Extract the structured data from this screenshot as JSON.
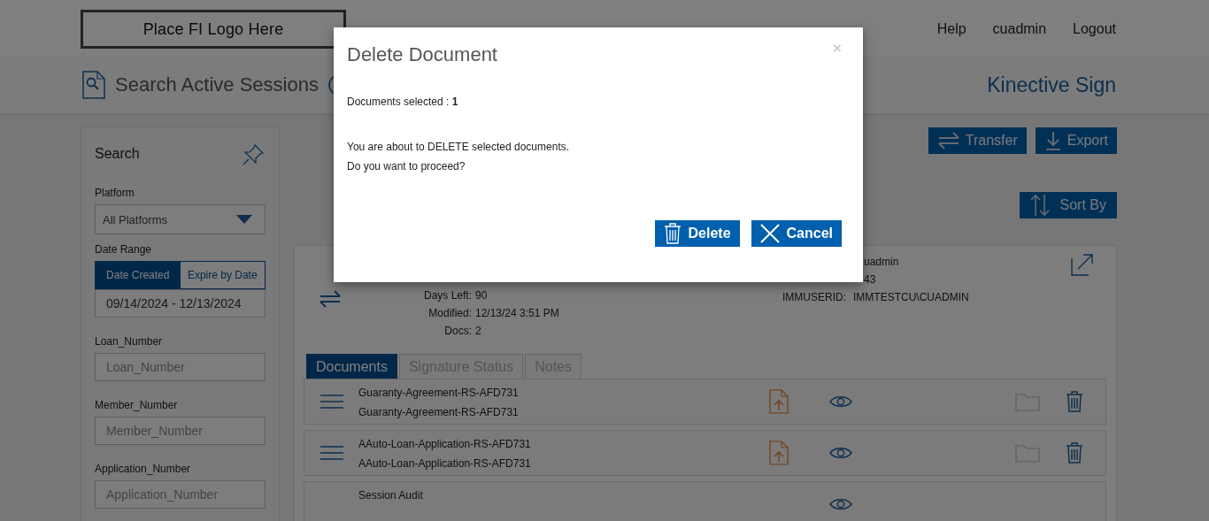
{
  "header": {
    "logo": "Place FI Logo Here",
    "nav": [
      "Help",
      "cuadmin",
      "Logout"
    ]
  },
  "page": {
    "title": "Search Active Sessions",
    "product": "Kinective Sign"
  },
  "search_panel": {
    "title": "Search",
    "fields": [
      {
        "kind": "select",
        "label": "Platform",
        "value": "All Platforms"
      },
      {
        "kind": "daterange",
        "label": "Date Range",
        "options": [
          {
            "label": "Date Created",
            "selected": true
          },
          {
            "label": "Expire by Date",
            "selected": false
          }
        ],
        "value": "09/14/2024 - 12/13/2024"
      },
      {
        "kind": "text",
        "label": "Loan_Number",
        "placeholder": "Loan_Number"
      },
      {
        "kind": "text",
        "label": "Member_Number",
        "placeholder": "Member_Number"
      },
      {
        "kind": "text",
        "label": "Application_Number",
        "placeholder": "Application_Number"
      }
    ]
  },
  "toolbar": {
    "buttons": [
      {
        "kind": "transfer",
        "label": "Transfer"
      },
      {
        "kind": "export",
        "label": "Export"
      }
    ],
    "sort": {
      "label": "Sort By"
    }
  },
  "session": {
    "details": [
      {
        "label": "Days Left:",
        "value": "90"
      },
      {
        "label": "Modified:",
        "value": "12/13/24 3:51 PM"
      },
      {
        "label": "Docs:",
        "value": "2"
      }
    ],
    "right_details": [
      {
        "value": "uadmin"
      },
      {
        "value": "43"
      },
      {
        "label": "IMMUSERID:",
        "value": "IMMTESTCU\\CUADMIN"
      }
    ],
    "tabs": [
      {
        "label": "Documents",
        "selected": true
      },
      {
        "label": "Signature Status",
        "selected": false
      },
      {
        "label": "Notes",
        "selected": false
      }
    ],
    "documents": [
      {
        "kind": "document",
        "title": "Guaranty-Agreement-RS-AFD731",
        "subtitle": "Guaranty-Agreement-RS-AFD731"
      },
      {
        "kind": "document",
        "title": "AAuto-Loan-Application-RS-AFD731",
        "subtitle": "AAuto-Loan-Application-RS-AFD731"
      },
      {
        "kind": "audit",
        "title": "Session Audit"
      }
    ]
  },
  "dialog": {
    "title": "Delete Document",
    "close": "×",
    "summary": "Documents selected : **1**",
    "message": [
      "You are about to DELETE selected documents.",
      "Do you want to proceed?"
    ],
    "buttons": [
      {
        "kind": "delete",
        "label": "Delete"
      },
      {
        "kind": "cancel",
        "label": "Cancel"
      }
    ]
  }
}
